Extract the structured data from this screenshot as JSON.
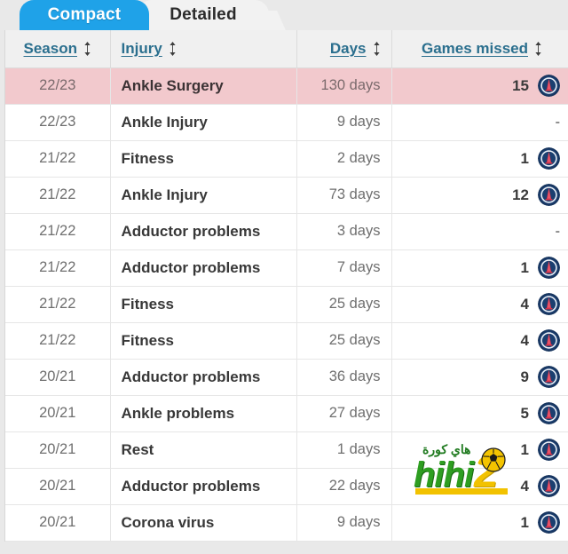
{
  "tabs": [
    {
      "id": "compact",
      "label": "Compact",
      "active": true
    },
    {
      "id": "detailed",
      "label": "Detailed",
      "active": false
    }
  ],
  "table": {
    "columns": [
      {
        "key": "season",
        "label": "Season",
        "sortable": true,
        "align": "center"
      },
      {
        "key": "injury",
        "label": "Injury",
        "sortable": true,
        "align": "left"
      },
      {
        "key": "days",
        "label": "Days",
        "sortable": true,
        "align": "right"
      },
      {
        "key": "games",
        "label": "Games missed",
        "sortable": true,
        "align": "right"
      }
    ],
    "sort_icon": "sort-updown-icon",
    "rows": [
      {
        "season": "22/23",
        "injury": "Ankle Surgery",
        "days": "130 days",
        "games": "15",
        "badge": true,
        "highlight": true
      },
      {
        "season": "22/23",
        "injury": "Ankle Injury",
        "days": "9 days",
        "games": "-",
        "badge": false,
        "highlight": false
      },
      {
        "season": "21/22",
        "injury": "Fitness",
        "days": "2 days",
        "games": "1",
        "badge": true,
        "highlight": false
      },
      {
        "season": "21/22",
        "injury": "Ankle Injury",
        "days": "73 days",
        "games": "12",
        "badge": true,
        "highlight": false
      },
      {
        "season": "21/22",
        "injury": "Adductor problems",
        "days": "3 days",
        "games": "-",
        "badge": false,
        "highlight": false
      },
      {
        "season": "21/22",
        "injury": "Adductor problems",
        "days": "7 days",
        "games": "1",
        "badge": true,
        "highlight": false
      },
      {
        "season": "21/22",
        "injury": "Fitness",
        "days": "25 days",
        "games": "4",
        "badge": true,
        "highlight": false
      },
      {
        "season": "21/22",
        "injury": "Fitness",
        "days": "25 days",
        "games": "4",
        "badge": true,
        "highlight": false
      },
      {
        "season": "20/21",
        "injury": "Adductor problems",
        "days": "36 days",
        "games": "9",
        "badge": true,
        "highlight": false
      },
      {
        "season": "20/21",
        "injury": "Ankle problems",
        "days": "27 days",
        "games": "5",
        "badge": true,
        "highlight": false
      },
      {
        "season": "20/21",
        "injury": "Rest",
        "days": "1 days",
        "games": "1",
        "badge": true,
        "highlight": false
      },
      {
        "season": "20/21",
        "injury": "Adductor problems",
        "days": "22 days",
        "games": "4",
        "badge": true,
        "highlight": false
      },
      {
        "season": "20/21",
        "injury": "Corona virus",
        "days": "9 days",
        "games": "1",
        "badge": true,
        "highlight": false
      }
    ],
    "badge_name": "club-crest-icon"
  },
  "watermark": {
    "arabic": "هاي كورة",
    "text": "hihi",
    "number": "2",
    "ball": "football-icon"
  },
  "colors": {
    "tab_active_bg": "#1fa2e8",
    "tab_inactive_bg": "#f2f2f2",
    "header_link": "#2b6f8e",
    "row_highlight": "#f2c9cd",
    "badge_navy": "#17355f",
    "watermark_green": "#2e9e21",
    "watermark_yellow": "#f2c200"
  }
}
